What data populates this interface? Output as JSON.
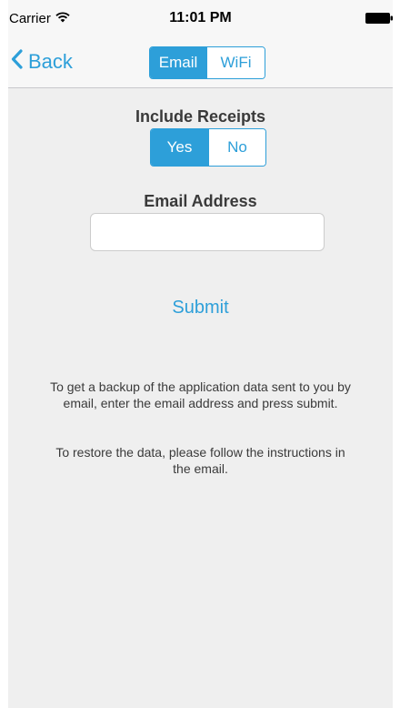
{
  "status_bar": {
    "carrier": "Carrier",
    "wifi_icon": "wifi-icon",
    "time": "11:01 PM",
    "battery_icon": "battery-icon"
  },
  "nav": {
    "back_label": "Back",
    "back_icon": "chevron-left-icon",
    "tabs": [
      {
        "label": "Email",
        "selected": true
      },
      {
        "label": "WiFi",
        "selected": false
      }
    ]
  },
  "receipts": {
    "label": "Include Receipts",
    "options": [
      {
        "label": "Yes",
        "selected": true
      },
      {
        "label": "No",
        "selected": false
      }
    ]
  },
  "email": {
    "label": "Email Address",
    "value": "",
    "placeholder": ""
  },
  "submit_label": "Submit",
  "info": {
    "backup_text": "To get a backup of the application data sent to you by email, enter the email address and press submit.",
    "restore_text": "To restore the data, please follow the instructions in the email."
  },
  "colors": {
    "accent": "#2d9fd9",
    "background": "#efefef",
    "bar": "#f7f7f7",
    "text": "#3a3a3a"
  }
}
